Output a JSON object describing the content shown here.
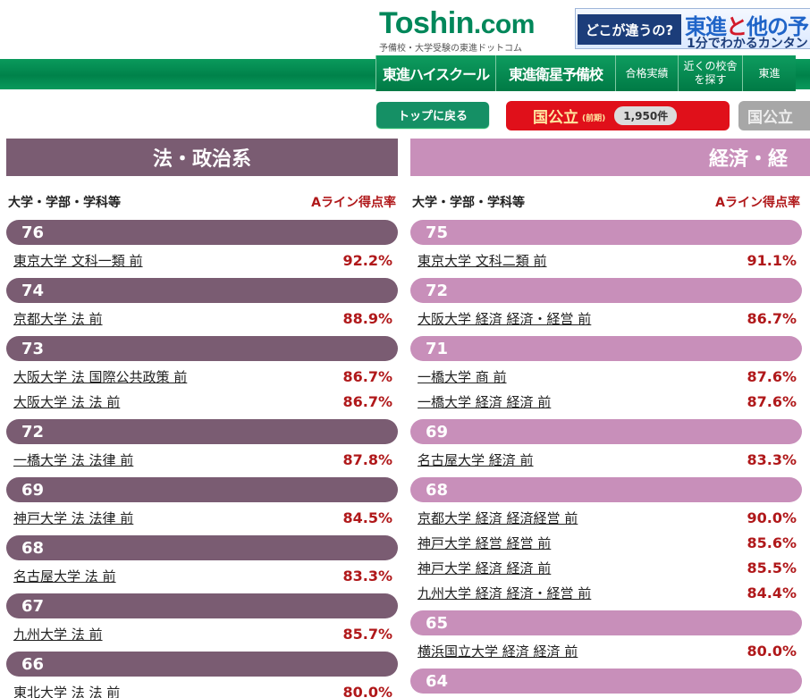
{
  "header": {
    "logo_text": "Toshin",
    "logo_dot": ".com",
    "logo_sub": "予備校・大学受験の東進ドットコム",
    "banner": {
      "question": "どこが違うの?",
      "title_a": "東進",
      "title_to": "と",
      "title_b": "他の予",
      "sub": "1分でわかるカンタン"
    }
  },
  "nav": [
    {
      "label": "東進ハイスクール"
    },
    {
      "label": "東進衛星予備校"
    },
    {
      "label": "合格実績"
    },
    {
      "label": "近くの校舎を探す"
    },
    {
      "label": "東進"
    }
  ],
  "buttons": {
    "top": "トップに戻る",
    "national_title": "国公立",
    "national_suffix": "(前期)",
    "national_count": "1,950件",
    "gray": "国公立"
  },
  "columns": [
    {
      "title": "法・政治系",
      "sub_label": "大学・学部・学科等",
      "sub_rate": "Aライン得点率",
      "groups": [
        {
          "score": "76",
          "items": [
            {
              "name": "東京大学 文科一類 前",
              "pct": "92.2%"
            }
          ]
        },
        {
          "score": "74",
          "items": [
            {
              "name": "京都大学 法 前",
              "pct": "88.9%"
            }
          ]
        },
        {
          "score": "73",
          "items": [
            {
              "name": "大阪大学 法 国際公共政策 前",
              "pct": "86.7%"
            },
            {
              "name": "大阪大学 法 法 前",
              "pct": "86.7%"
            }
          ]
        },
        {
          "score": "72",
          "items": [
            {
              "name": "一橋大学 法 法律 前",
              "pct": "87.8%"
            }
          ]
        },
        {
          "score": "69",
          "items": [
            {
              "name": "神戸大学 法 法律 前",
              "pct": "84.5%"
            }
          ]
        },
        {
          "score": "68",
          "items": [
            {
              "name": "名古屋大学 法 前",
              "pct": "83.3%"
            }
          ]
        },
        {
          "score": "67",
          "items": [
            {
              "name": "九州大学 法 前",
              "pct": "85.7%"
            }
          ]
        },
        {
          "score": "66",
          "items": [
            {
              "name": "東北大学 法 法 前",
              "pct": "80.0%"
            }
          ]
        }
      ]
    },
    {
      "title": "経済・経",
      "sub_label": "大学・学部・学科等",
      "sub_rate": "Aライン得点率",
      "groups": [
        {
          "score": "75",
          "items": [
            {
              "name": "東京大学 文科二類 前",
              "pct": "91.1%"
            }
          ]
        },
        {
          "score": "72",
          "items": [
            {
              "name": "大阪大学 経済 経済・経営 前",
              "pct": "86.7%"
            }
          ]
        },
        {
          "score": "71",
          "items": [
            {
              "name": "一橋大学 商 前",
              "pct": "87.6%"
            },
            {
              "name": "一橋大学 経済 経済 前",
              "pct": "87.6%"
            }
          ]
        },
        {
          "score": "69",
          "items": [
            {
              "name": "名古屋大学 経済 前",
              "pct": "83.3%"
            }
          ]
        },
        {
          "score": "68",
          "items": [
            {
              "name": "京都大学 経済 経済経営 前",
              "pct": "90.0%"
            },
            {
              "name": "神戸大学 経営 経営 前",
              "pct": "85.6%"
            },
            {
              "name": "神戸大学 経済 経済 前",
              "pct": "85.5%"
            },
            {
              "name": "九州大学 経済 経済・経営 前",
              "pct": "84.4%"
            }
          ]
        },
        {
          "score": "65",
          "items": [
            {
              "name": "横浜国立大学 経済 経済 前",
              "pct": "80.0%"
            }
          ]
        },
        {
          "score": "64",
          "items": []
        }
      ]
    }
  ]
}
